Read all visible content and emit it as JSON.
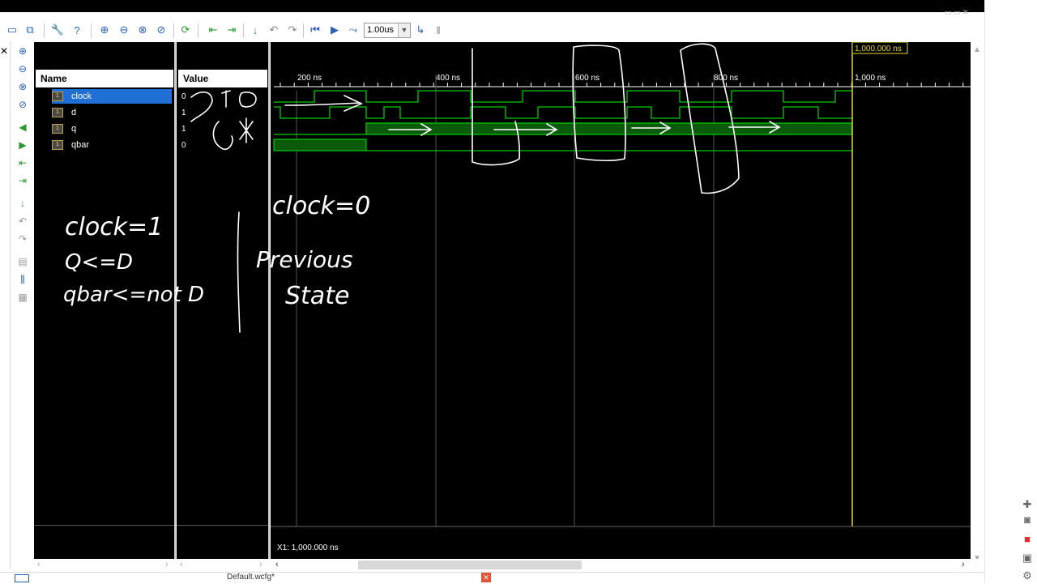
{
  "toolbar": {
    "zoom_value": "1.00us"
  },
  "signals": {
    "header_name": "Name",
    "header_value": "Value",
    "items": [
      {
        "name": "clock",
        "value": "0",
        "selected": true
      },
      {
        "name": "d",
        "value": "1"
      },
      {
        "name": "q",
        "value": "1"
      },
      {
        "name": "qbar",
        "value": "0"
      }
    ]
  },
  "timeline": {
    "labels": [
      "200 ns",
      "400 ns",
      "600 ns",
      "800 ns",
      "1,000 ns"
    ],
    "cursor_label": "1,000.000 ns",
    "cursor_readout": "X1: 1,000.000 ns"
  },
  "annotations": {
    "left_notes": [
      "clock=1",
      "Q<=D",
      "qbar<=not D"
    ],
    "right_notes": [
      "clock=0",
      "Previous",
      "State"
    ]
  },
  "status": {
    "tab_label": "Default.wcfg*"
  },
  "colors": {
    "wave_green": "#00cc00",
    "wave_fill": "#0b5a0b",
    "cursor_yellow": "#e8d62a",
    "selection_blue": "#1f6fd6"
  }
}
